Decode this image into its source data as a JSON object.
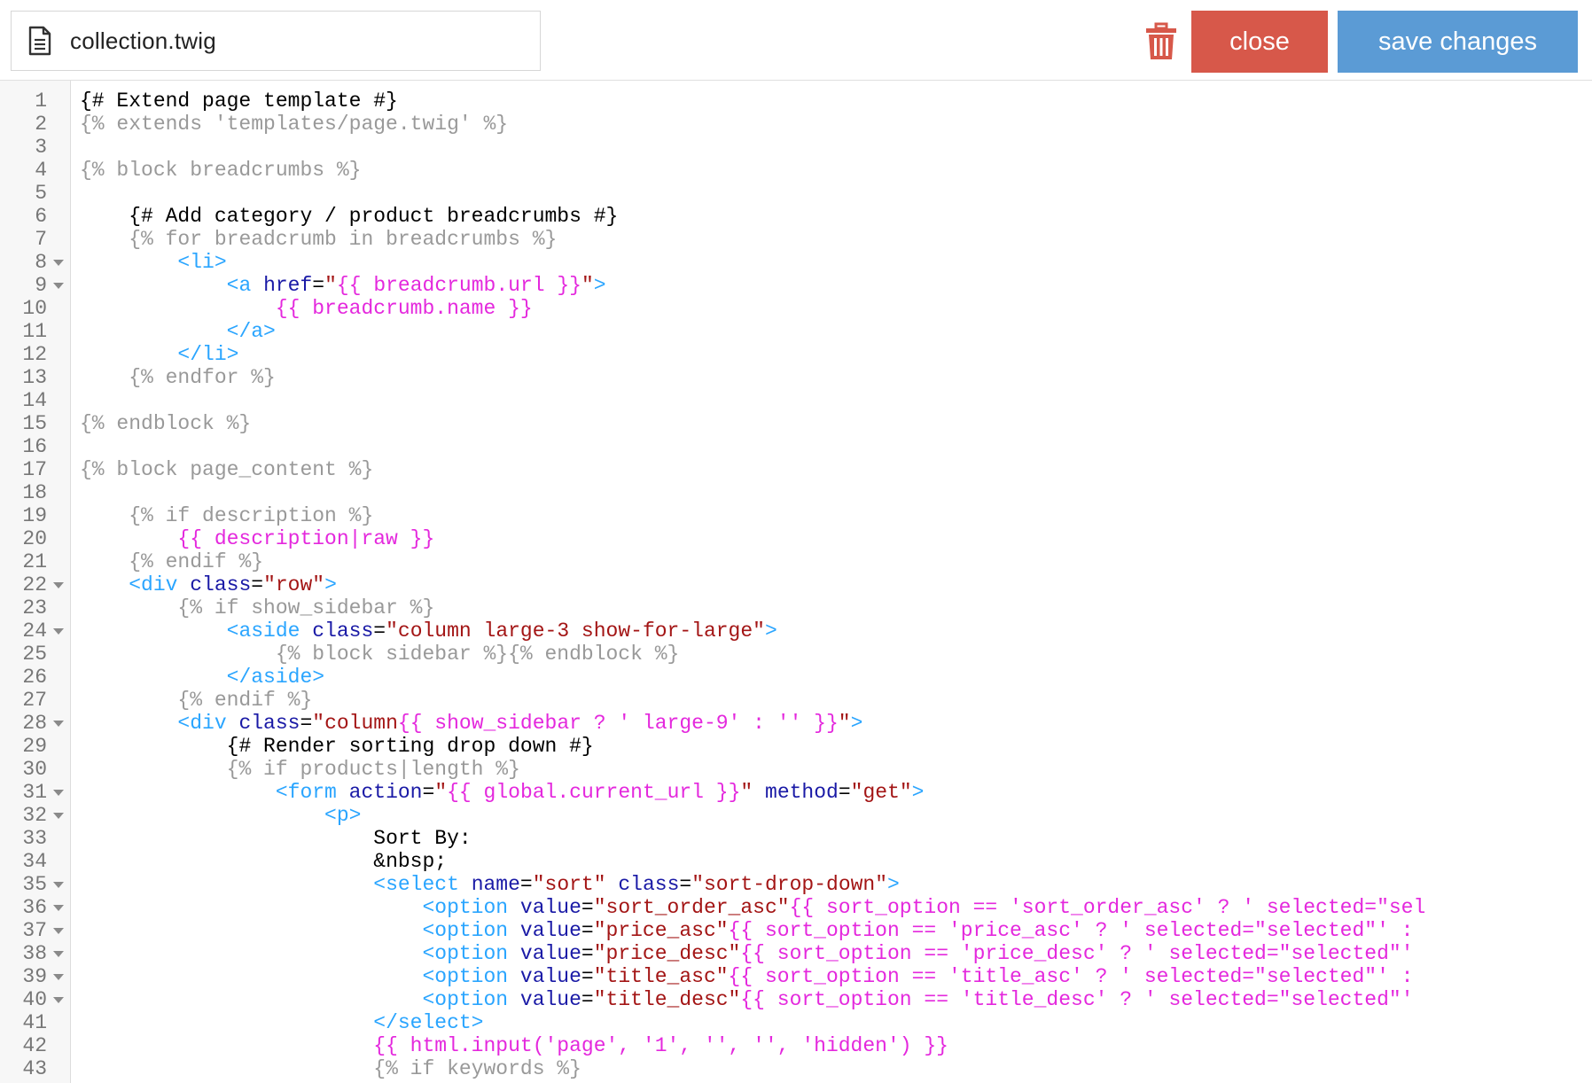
{
  "header": {
    "filename": "collection.twig",
    "file_icon": "document-icon",
    "delete_icon": "trash-icon",
    "close_label": "close",
    "save_label": "save changes",
    "colors": {
      "close": "#d7584a",
      "save": "#5b9bd5",
      "trash": "#d7584a"
    }
  },
  "editor": {
    "lines": [
      {
        "n": "1",
        "fold": false,
        "indent": "",
        "tokens": [
          {
            "t": "comment",
            "v": "{# Extend page template #}"
          }
        ]
      },
      {
        "n": "2",
        "fold": false,
        "indent": "",
        "tokens": [
          {
            "t": "tag",
            "v": "{% extends 'templates/page.twig' %}"
          }
        ]
      },
      {
        "n": "3",
        "fold": false,
        "indent": "",
        "tokens": []
      },
      {
        "n": "4",
        "fold": false,
        "indent": "",
        "tokens": [
          {
            "t": "tag",
            "v": "{% block breadcrumbs %}"
          }
        ]
      },
      {
        "n": "5",
        "fold": false,
        "indent": "",
        "tokens": []
      },
      {
        "n": "6",
        "fold": false,
        "indent": "    ",
        "tokens": [
          {
            "t": "comment",
            "v": "{# Add category / product breadcrumbs #}"
          }
        ]
      },
      {
        "n": "7",
        "fold": false,
        "indent": "    ",
        "tokens": [
          {
            "t": "tag",
            "v": "{% for breadcrumb in breadcrumbs %}"
          }
        ]
      },
      {
        "n": "8",
        "fold": true,
        "indent": "        ",
        "tokens": [
          {
            "t": "html",
            "v": "<li>"
          }
        ]
      },
      {
        "n": "9",
        "fold": true,
        "indent": "            ",
        "tokens": [
          {
            "t": "html",
            "v": "<a "
          },
          {
            "t": "attr",
            "v": "href"
          },
          {
            "t": "eq",
            "v": "="
          },
          {
            "t": "str",
            "v": "\""
          },
          {
            "t": "var",
            "v": "{{ breadcrumb.url }}"
          },
          {
            "t": "str",
            "v": "\""
          },
          {
            "t": "html",
            "v": ">"
          }
        ]
      },
      {
        "n": "10",
        "fold": false,
        "indent": "                ",
        "tokens": [
          {
            "t": "var",
            "v": "{{ breadcrumb.name }}"
          }
        ]
      },
      {
        "n": "11",
        "fold": false,
        "indent": "            ",
        "tokens": [
          {
            "t": "html",
            "v": "</a>"
          }
        ]
      },
      {
        "n": "12",
        "fold": false,
        "indent": "        ",
        "tokens": [
          {
            "t": "html",
            "v": "</li>"
          }
        ]
      },
      {
        "n": "13",
        "fold": false,
        "indent": "    ",
        "tokens": [
          {
            "t": "tag",
            "v": "{% endfor %}"
          }
        ]
      },
      {
        "n": "14",
        "fold": false,
        "indent": "",
        "tokens": []
      },
      {
        "n": "15",
        "fold": false,
        "indent": "",
        "tokens": [
          {
            "t": "tag",
            "v": "{% endblock %}"
          }
        ]
      },
      {
        "n": "16",
        "fold": false,
        "indent": "",
        "tokens": []
      },
      {
        "n": "17",
        "fold": false,
        "indent": "",
        "tokens": [
          {
            "t": "tag",
            "v": "{% block page_content %}"
          }
        ]
      },
      {
        "n": "18",
        "fold": false,
        "indent": "",
        "tokens": []
      },
      {
        "n": "19",
        "fold": false,
        "indent": "    ",
        "tokens": [
          {
            "t": "tag",
            "v": "{% if description %}"
          }
        ]
      },
      {
        "n": "20",
        "fold": false,
        "indent": "        ",
        "tokens": [
          {
            "t": "var",
            "v": "{{ description|raw }}"
          }
        ]
      },
      {
        "n": "21",
        "fold": false,
        "indent": "    ",
        "tokens": [
          {
            "t": "tag",
            "v": "{% endif %}"
          }
        ]
      },
      {
        "n": "22",
        "fold": true,
        "indent": "    ",
        "tokens": [
          {
            "t": "html",
            "v": "<div "
          },
          {
            "t": "attr",
            "v": "class"
          },
          {
            "t": "eq",
            "v": "="
          },
          {
            "t": "str",
            "v": "\"row\""
          },
          {
            "t": "html",
            "v": ">"
          }
        ]
      },
      {
        "n": "23",
        "fold": false,
        "indent": "        ",
        "tokens": [
          {
            "t": "tag",
            "v": "{% if show_sidebar %}"
          }
        ]
      },
      {
        "n": "24",
        "fold": true,
        "indent": "            ",
        "tokens": [
          {
            "t": "html",
            "v": "<aside "
          },
          {
            "t": "attr",
            "v": "class"
          },
          {
            "t": "eq",
            "v": "="
          },
          {
            "t": "str",
            "v": "\"column large-3 show-for-large\""
          },
          {
            "t": "html",
            "v": ">"
          }
        ]
      },
      {
        "n": "25",
        "fold": false,
        "indent": "                ",
        "tokens": [
          {
            "t": "tag",
            "v": "{% block sidebar %}{% endblock %}"
          }
        ]
      },
      {
        "n": "26",
        "fold": false,
        "indent": "            ",
        "tokens": [
          {
            "t": "html",
            "v": "</aside>"
          }
        ]
      },
      {
        "n": "27",
        "fold": false,
        "indent": "        ",
        "tokens": [
          {
            "t": "tag",
            "v": "{% endif %}"
          }
        ]
      },
      {
        "n": "28",
        "fold": true,
        "indent": "        ",
        "tokens": [
          {
            "t": "html",
            "v": "<div "
          },
          {
            "t": "attr",
            "v": "class"
          },
          {
            "t": "eq",
            "v": "="
          },
          {
            "t": "str",
            "v": "\"column"
          },
          {
            "t": "var",
            "v": "{{ show_sidebar ? ' large-9' : '' }}"
          },
          {
            "t": "str",
            "v": "\""
          },
          {
            "t": "html",
            "v": ">"
          }
        ]
      },
      {
        "n": "29",
        "fold": false,
        "indent": "            ",
        "tokens": [
          {
            "t": "comment",
            "v": "{# Render sorting drop down #}"
          }
        ]
      },
      {
        "n": "30",
        "fold": false,
        "indent": "            ",
        "tokens": [
          {
            "t": "tag",
            "v": "{% if products|length %}"
          }
        ]
      },
      {
        "n": "31",
        "fold": true,
        "indent": "                ",
        "tokens": [
          {
            "t": "html",
            "v": "<form "
          },
          {
            "t": "attr",
            "v": "action"
          },
          {
            "t": "eq",
            "v": "="
          },
          {
            "t": "str",
            "v": "\""
          },
          {
            "t": "var",
            "v": "{{ global.current_url }}"
          },
          {
            "t": "str",
            "v": "\""
          },
          {
            "t": "text",
            "v": " "
          },
          {
            "t": "attr",
            "v": "method"
          },
          {
            "t": "eq",
            "v": "="
          },
          {
            "t": "str",
            "v": "\"get\""
          },
          {
            "t": "html",
            "v": ">"
          }
        ]
      },
      {
        "n": "32",
        "fold": true,
        "indent": "                    ",
        "tokens": [
          {
            "t": "html",
            "v": "<p>"
          }
        ]
      },
      {
        "n": "33",
        "fold": false,
        "indent": "                        ",
        "tokens": [
          {
            "t": "text",
            "v": "Sort By:"
          }
        ]
      },
      {
        "n": "34",
        "fold": false,
        "indent": "                        ",
        "tokens": [
          {
            "t": "text",
            "v": "&nbsp;"
          }
        ]
      },
      {
        "n": "35",
        "fold": true,
        "indent": "                        ",
        "tokens": [
          {
            "t": "html",
            "v": "<select "
          },
          {
            "t": "attr",
            "v": "name"
          },
          {
            "t": "eq",
            "v": "="
          },
          {
            "t": "str",
            "v": "\"sort\""
          },
          {
            "t": "text",
            "v": " "
          },
          {
            "t": "attr",
            "v": "class"
          },
          {
            "t": "eq",
            "v": "="
          },
          {
            "t": "str",
            "v": "\"sort-drop-down\""
          },
          {
            "t": "html",
            "v": ">"
          }
        ]
      },
      {
        "n": "36",
        "fold": true,
        "indent": "                            ",
        "tokens": [
          {
            "t": "html",
            "v": "<option "
          },
          {
            "t": "attr",
            "v": "value"
          },
          {
            "t": "eq",
            "v": "="
          },
          {
            "t": "str",
            "v": "\"sort_order_asc\""
          },
          {
            "t": "var",
            "v": "{{ sort_option == 'sort_order_asc' ? ' selected=\"sel"
          }
        ]
      },
      {
        "n": "37",
        "fold": true,
        "indent": "                            ",
        "tokens": [
          {
            "t": "html",
            "v": "<option "
          },
          {
            "t": "attr",
            "v": "value"
          },
          {
            "t": "eq",
            "v": "="
          },
          {
            "t": "str",
            "v": "\"price_asc\""
          },
          {
            "t": "var",
            "v": "{{ sort_option == 'price_asc' ? ' selected=\"selected\"' :"
          }
        ]
      },
      {
        "n": "38",
        "fold": true,
        "indent": "                            ",
        "tokens": [
          {
            "t": "html",
            "v": "<option "
          },
          {
            "t": "attr",
            "v": "value"
          },
          {
            "t": "eq",
            "v": "="
          },
          {
            "t": "str",
            "v": "\"price_desc\""
          },
          {
            "t": "var",
            "v": "{{ sort_option == 'price_desc' ? ' selected=\"selected\"'"
          }
        ]
      },
      {
        "n": "39",
        "fold": true,
        "indent": "                            ",
        "tokens": [
          {
            "t": "html",
            "v": "<option "
          },
          {
            "t": "attr",
            "v": "value"
          },
          {
            "t": "eq",
            "v": "="
          },
          {
            "t": "str",
            "v": "\"title_asc\""
          },
          {
            "t": "var",
            "v": "{{ sort_option == 'title_asc' ? ' selected=\"selected\"' :"
          }
        ]
      },
      {
        "n": "40",
        "fold": true,
        "indent": "                            ",
        "tokens": [
          {
            "t": "html",
            "v": "<option "
          },
          {
            "t": "attr",
            "v": "value"
          },
          {
            "t": "eq",
            "v": "="
          },
          {
            "t": "str",
            "v": "\"title_desc\""
          },
          {
            "t": "var",
            "v": "{{ sort_option == 'title_desc' ? ' selected=\"selected\"'"
          }
        ]
      },
      {
        "n": "41",
        "fold": false,
        "indent": "                        ",
        "tokens": [
          {
            "t": "html",
            "v": "</select>"
          }
        ]
      },
      {
        "n": "42",
        "fold": false,
        "indent": "                        ",
        "tokens": [
          {
            "t": "var",
            "v": "{{ html.input('page', '1', '', '', 'hidden') }}"
          }
        ]
      },
      {
        "n": "43",
        "fold": false,
        "indent": "                        ",
        "tokens": [
          {
            "t": "tag",
            "v": "{% if keywords %}"
          }
        ]
      }
    ]
  }
}
